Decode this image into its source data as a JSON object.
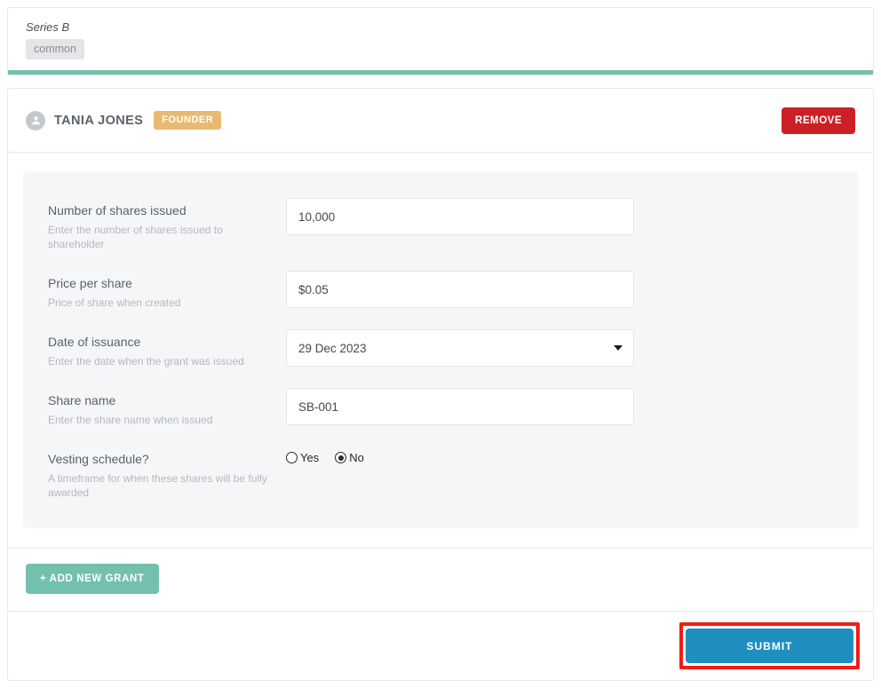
{
  "series": {
    "title": "Series B",
    "share_class": "common"
  },
  "grant": {
    "holder_name": "TANIA JONES",
    "role_badge": "FOUNDER",
    "remove_label": "REMOVE",
    "avatar_icon": "person-icon",
    "fields": [
      {
        "label": "Number of shares issued",
        "help": "Enter the number of shares issued to shareholder",
        "type": "text",
        "value": "10,000"
      },
      {
        "label": "Price per share",
        "help": "Price of share when created",
        "type": "text",
        "value": "$0.05"
      },
      {
        "label": "Date of issuance",
        "help": "Enter the date when the grant was issued",
        "type": "select",
        "value": "29 Dec 2023",
        "caret_icon": "chevron-down-icon"
      },
      {
        "label": "Share name",
        "help": "Enter the share name when issued",
        "type": "text",
        "value": "SB-001"
      },
      {
        "label": "Vesting schedule?",
        "help": "A timeframe for when these shares will be fully awarded",
        "type": "radio",
        "options": [
          {
            "label": "Yes",
            "selected": false
          },
          {
            "label": "No",
            "selected": true
          }
        ]
      }
    ]
  },
  "actions": {
    "add_grant_label": "+ ADD NEW GRANT",
    "submit_label": "SUBMIT"
  },
  "colors": {
    "accent_teal": "#74c0ae",
    "remove_red": "#cd2026",
    "founder_amber": "#eab971",
    "submit_blue": "#1f8fc0",
    "highlight_red": "#ef1d17"
  }
}
